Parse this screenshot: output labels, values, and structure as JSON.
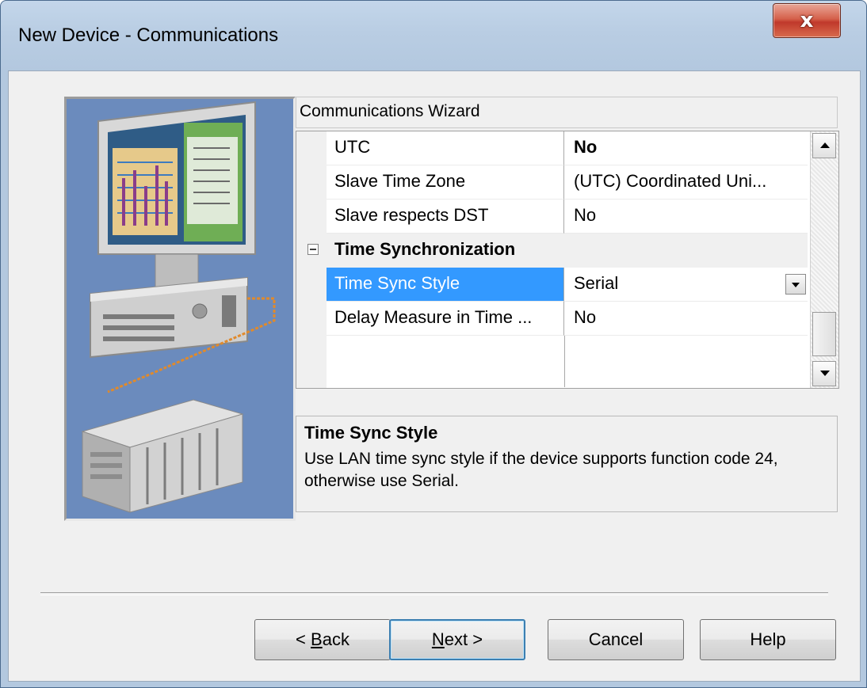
{
  "window": {
    "title": "New Device - Communications",
    "close_label": "x"
  },
  "wizard": {
    "header": "Communications Wizard"
  },
  "grid": {
    "rows": [
      {
        "name": "UTC",
        "value": "No",
        "bold_value": true
      },
      {
        "name": "Slave Time Zone",
        "value": "(UTC) Coordinated Uni..."
      },
      {
        "name": "Slave respects DST",
        "value": "No"
      }
    ],
    "category": {
      "name": "Time Synchronization",
      "expanded": true
    },
    "sub_rows": [
      {
        "name": "Time Sync Style",
        "value": "Serial",
        "selected": true,
        "has_dropdown": true
      },
      {
        "name": "Delay Measure in Time ...",
        "value": "No"
      }
    ]
  },
  "description": {
    "title": "Time Sync Style",
    "text": "Use LAN time sync style if the device supports function code 24, otherwise use Serial."
  },
  "buttons": {
    "back": {
      "prefix": "< ",
      "mnemonic": "B",
      "rest": "ack"
    },
    "next": {
      "mnemonic": "N",
      "rest": "ext >"
    },
    "cancel": "Cancel",
    "help": "Help"
  },
  "colors": {
    "selection": "#3399ff",
    "art_background": "#6b8bbd",
    "close_button": "#c0392b"
  }
}
